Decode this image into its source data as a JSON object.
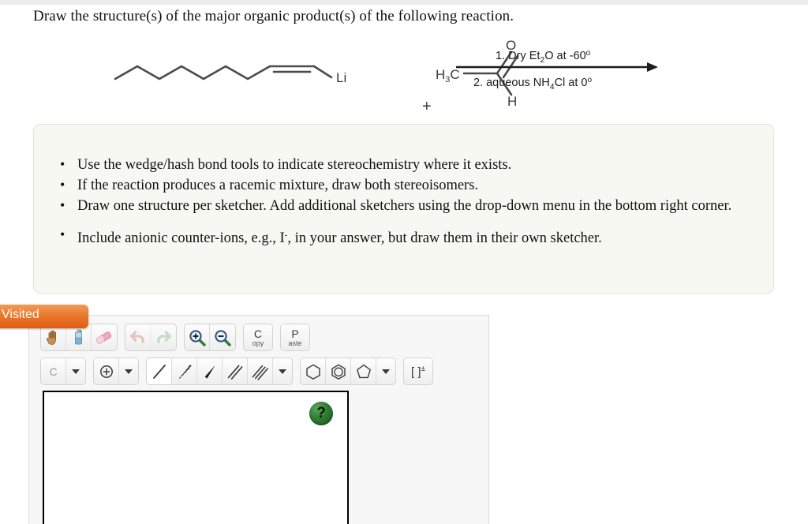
{
  "prompt": "Draw the structure(s) of the major organic product(s) of the following reaction.",
  "reaction": {
    "reagent_label": "Li",
    "plus": "+",
    "aldehyde_methyl": "H",
    "aldehyde_methyl_sub": "3",
    "aldehyde_methyl_c": "C",
    "aldehyde_oxygen": "O",
    "aldehyde_hydrogen": "H",
    "condition_top": "1. Dry Et",
    "condition_top_sub": "2",
    "condition_top_rest": "O at -60",
    "condition_top_deg": "o",
    "condition_bottom": "2. aqueous NH",
    "condition_bottom_sub": "4",
    "condition_bottom_rest": "Cl at 0",
    "condition_bottom_deg": "o"
  },
  "instructions": [
    "Use the wedge/hash bond tools to indicate stereochemistry where it exists.",
    "If the reaction produces a racemic mixture, draw both stereoisomers.",
    "Draw one structure per sketcher. Add additional sketchers using the drop-down menu in the bottom right corner.",
    "Include anionic counter-ions, e.g., I",
    ", in your answer, but draw them in their own sketcher."
  ],
  "instruction_superscript": "-",
  "visited_badge": "Visited",
  "sketcher": {
    "toolbar_row1": [
      {
        "name": "pan-hand-icon",
        "label": "Pan"
      },
      {
        "name": "clean-structure-icon",
        "label": "Clean"
      },
      {
        "name": "eraser-icon",
        "label": "Erase"
      },
      {
        "name": "undo-icon",
        "label": "Undo"
      },
      {
        "name": "redo-icon",
        "label": "Redo"
      },
      {
        "name": "zoom-in-icon",
        "label": "Zoom In"
      },
      {
        "name": "zoom-out-icon",
        "label": "Zoom Out"
      }
    ],
    "copy_letter": "C",
    "copy_rest": "opy",
    "paste_letter": "P",
    "paste_rest": "aste",
    "element_label": "C",
    "charge_symbol": "⊕",
    "bracket_label": "[ ]",
    "bracket_sup": "±",
    "bond_tools": [
      {
        "name": "single-bond-tool",
        "label": "Single bond",
        "selected": true
      },
      {
        "name": "hash-bond-tool",
        "label": "Hash bond",
        "selected": false
      },
      {
        "name": "wedge-bond-tool",
        "label": "Wedge bond",
        "selected": false
      },
      {
        "name": "double-bond-tool",
        "label": "Double bond",
        "selected": false
      },
      {
        "name": "triple-bond-tool",
        "label": "Triple bond",
        "selected": false
      }
    ],
    "ring_tools": [
      {
        "name": "cyclohexane-ring-tool",
        "label": "Cyclohexane"
      },
      {
        "name": "benzene-ring-tool",
        "label": "Benzene"
      },
      {
        "name": "cyclopentane-ring-tool",
        "label": "Cyclopentane"
      }
    ],
    "help_label": "?"
  },
  "colors": {
    "badge_orange": "#e9772b",
    "help_green": "#2e7d32",
    "bond_gray": "#4a4a4a",
    "panel_gray": "#f7f7f7",
    "instruction_bg": "#f8f8f3"
  }
}
